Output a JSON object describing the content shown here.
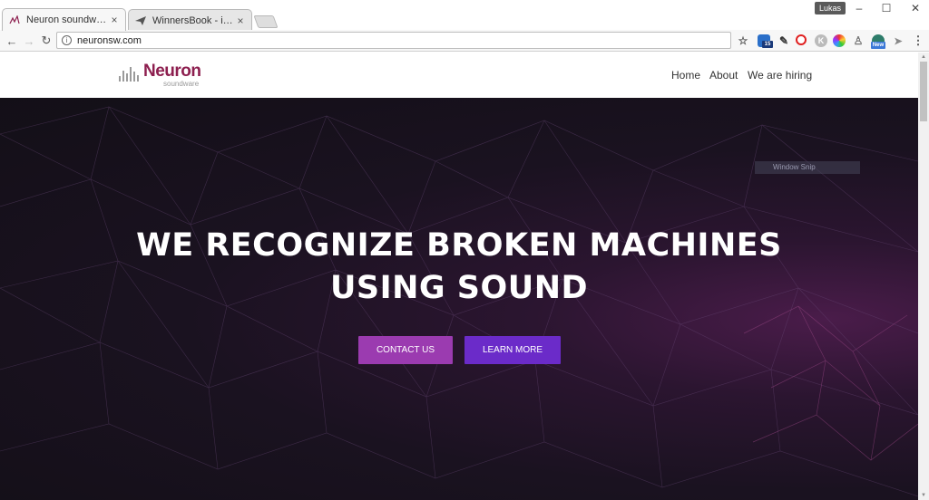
{
  "browser": {
    "tabs": [
      {
        "title": "Neuron soundware – We",
        "active": true
      },
      {
        "title": "WinnersBook - inspirace",
        "active": false
      }
    ],
    "profile_name": "Lukas",
    "address": "neuronsw.com",
    "extensions": [
      {
        "icon": "star-icon",
        "badge": ""
      },
      {
        "icon": "ext-blue-badge-icon",
        "badge": "15"
      },
      {
        "icon": "ext-eyedropper-icon",
        "badge": ""
      },
      {
        "icon": "opera-icon",
        "badge": ""
      },
      {
        "icon": "ext-gray-k-icon",
        "badge": ""
      },
      {
        "icon": "ext-colorwheel-icon",
        "badge": ""
      },
      {
        "icon": "ext-person-icon",
        "badge": ""
      },
      {
        "icon": "ext-gauge-icon",
        "badge": "New"
      },
      {
        "icon": "ext-send-icon",
        "badge": ""
      }
    ]
  },
  "site": {
    "logo_name": "Neuron",
    "logo_sub": "soundware",
    "nav": [
      "Home",
      "About",
      "We are hiring"
    ],
    "headline_line1": "WE RECOGNIZE BROKEN MACHINES",
    "headline_line2": "USING SOUND",
    "cta_contact": "CONTACT US",
    "cta_learn": "LEARN MORE",
    "overlay_text": "Window Snip"
  },
  "colors": {
    "brand": "#8d1f4f",
    "contact_button": "#9b3bb0",
    "learn_button": "#6b2bc9",
    "hero_bg": "#17111c"
  }
}
